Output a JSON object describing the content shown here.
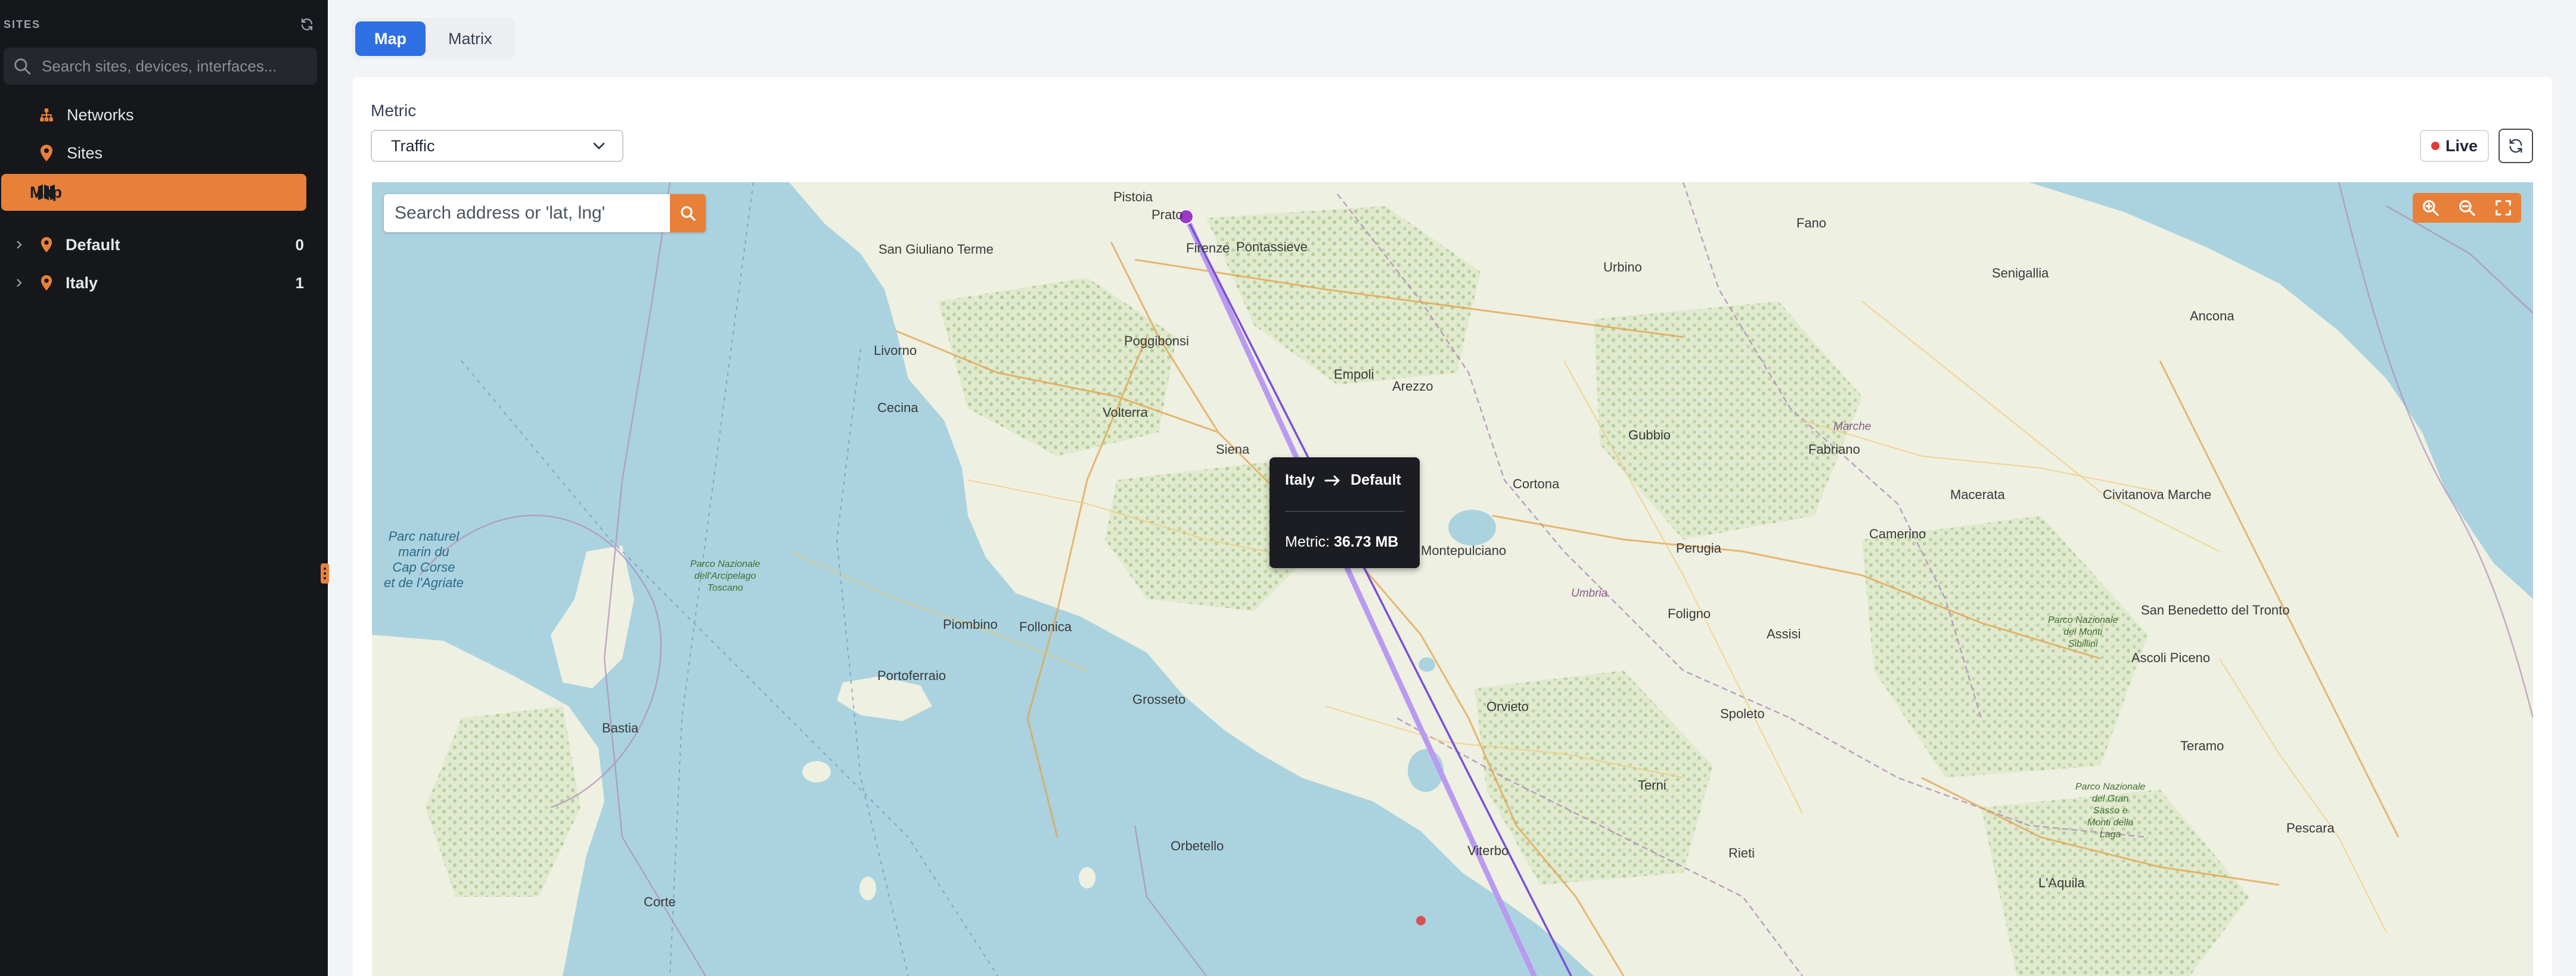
{
  "sidebar": {
    "title": "SITES",
    "search_placeholder": "Search sites, devices, interfaces...",
    "nav": [
      {
        "label": "Networks",
        "icon": "network-icon"
      },
      {
        "label": "Sites",
        "icon": "map-pin-icon"
      },
      {
        "label": "Map",
        "icon": "map-icon",
        "active": true
      }
    ],
    "tree": [
      {
        "label": "Default",
        "count": "0",
        "icon": "map-pin-icon"
      },
      {
        "label": "Italy",
        "count": "1",
        "icon": "map-pin-icon"
      }
    ]
  },
  "tabs": [
    {
      "label": "Map",
      "active": true
    },
    {
      "label": "Matrix",
      "active": false
    }
  ],
  "metric": {
    "label": "Metric",
    "selected": "Traffic"
  },
  "live_label": "Live",
  "map": {
    "search_placeholder": "Search address or 'lat, lng'",
    "labels": {
      "prato": "Prato",
      "firenze": "Firenze",
      "pistoia": "Pistoia",
      "pontassieve": "Pontassieve",
      "livorno": "Livorno",
      "pisa": "San Giuliano Terme",
      "siena": "Siena",
      "arezzo": "Arezzo",
      "perugia": "Perugia",
      "ancona": "Ancona",
      "grosseto": "Grosseto",
      "viterbo": "Viterbo",
      "orbetello": "Orbetello",
      "terni": "Terni",
      "rieti": "Rieti",
      "spoleto": "Spoleto",
      "foligno": "Foligno",
      "macerata": "Macerata",
      "ascoli": "Ascoli Piceno",
      "teramo": "Teramo",
      "pescara": "Pescara",
      "laquila": "L'Aquila",
      "piombino": "Piombino",
      "volterra": "Volterra",
      "urbino": "Urbino",
      "marche": "Marche",
      "umbria": "Umbria",
      "corte": "Corte",
      "bastia": "Bastia",
      "portoferraio": "Portoferraio",
      "cortona": "Cortona",
      "fano": "Fano",
      "senigallia": "Senigallia",
      "civitanova": "Civitanova Marche",
      "sanbenedetto": "San Benedetto del Tronto",
      "montepulciano": "Montepulciano",
      "empoli": "Empoli",
      "poggibonsi": "Poggibonsi",
      "cecina": "Cecina",
      "orvieto": "Orvieto",
      "follonica": "Follonica",
      "gubbio": "Gubbio",
      "assisi": "Assisi",
      "fabriano": "Fabriano",
      "camerino": "Camerino",
      "corsica_park": "Parc naturel\nmarin du\nCap Corse\net de l'Agriate",
      "toscano_park": "Parco Nazionale\ndell'Arcipelago\nToscano",
      "sibillini_park": "Parco Nazionale\ndei Monti\nSibillini",
      "gransasso_park": "Parco Nazionale\ndel Gran\nSasso e\nMonti della\nLaga"
    }
  },
  "tooltip": {
    "from": "Italy",
    "to": "Default",
    "metric_label": "Metric:",
    "metric_value": "36.73 MB"
  },
  "colors": {
    "sidebar_bg": "#15171b",
    "accent_orange": "#e8803a",
    "tab_active_blue": "#2f6fe4",
    "live_red": "#e23b3b",
    "link_purple": "#7a4fd9",
    "link_lavender": "#b99af0",
    "sea": "#aad3df",
    "land": "#eef0e2"
  }
}
